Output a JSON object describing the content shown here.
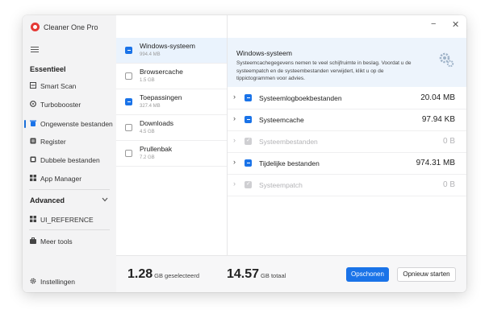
{
  "app": {
    "title": "Cleaner One Pro",
    "window_controls": {
      "minimize": "−",
      "close": "✕"
    }
  },
  "sidebar": {
    "section_essential": "Essentieel",
    "items": [
      {
        "label": "Smart Scan",
        "icon": "scan-icon"
      },
      {
        "label": "Turbobooster",
        "icon": "turbo-icon"
      },
      {
        "label": "Ongewenste bestanden",
        "icon": "junk-files-icon",
        "active": true
      },
      {
        "label": "Register",
        "icon": "registry-icon"
      },
      {
        "label": "Dubbele bestanden",
        "icon": "duplicate-files-icon"
      },
      {
        "label": "App Manager",
        "icon": "app-manager-icon"
      }
    ],
    "section_advanced": "Advanced",
    "advanced_items": [
      {
        "label": "UI_REFERENCE",
        "icon": "grid-icon"
      }
    ],
    "more_tools": "Meer tools",
    "settings": "Instellingen"
  },
  "categories": [
    {
      "name": "Windows-systeem",
      "size": "994.4 MB",
      "checked": "partial",
      "selected": true
    },
    {
      "name": "Browsercache",
      "size": "1.5 GB",
      "checked": "none"
    },
    {
      "name": "Toepassingen",
      "size": "327.4 MB",
      "checked": "partial"
    },
    {
      "name": "Downloads",
      "size": "4.5 GB",
      "checked": "none"
    },
    {
      "name": "Prullenbak",
      "size": "7.2 GB",
      "checked": "none"
    }
  ],
  "detail": {
    "title": "Windows-systeem",
    "description": "Systeemcachegegevens nemen te veel schijfruimte in beslag. Voordat u de systeempatch en de systeembestanden verwijdert, klikt u op de tippictogrammen voor advies.",
    "icon": "gear-icon",
    "rows": [
      {
        "name": "Systeemlogboekbestanden",
        "size": "20.04 MB",
        "state": "checked"
      },
      {
        "name": "Systeemcache",
        "size": "97.94 KB",
        "state": "partial"
      },
      {
        "name": "Systeembestanden",
        "size": "0 B",
        "state": "disabled"
      },
      {
        "name": "Tijdelijke bestanden",
        "size": "974.31 MB",
        "state": "checked"
      },
      {
        "name": "Systeempatch",
        "size": "0 B",
        "state": "disabled"
      }
    ]
  },
  "footer": {
    "selected_value": "1.28",
    "selected_unit": "GB geselecteerd",
    "total_value": "14.57",
    "total_unit": "GB totaal",
    "clean_button": "Opschonen",
    "rescan_button": "Opnieuw starten"
  },
  "colors": {
    "accent": "#1a73e8",
    "brand": "#e53935",
    "sidebar_bg": "#f3f3f4",
    "info_bg": "#edf4fc"
  }
}
